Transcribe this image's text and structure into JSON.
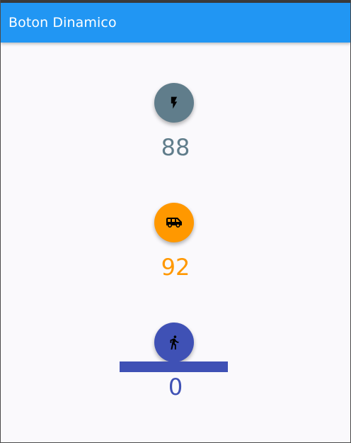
{
  "appbar": {
    "title": "Boton Dinamico"
  },
  "colors": {
    "appbar": "#2196f3",
    "slate": "#607d8b",
    "orange": "#ff9800",
    "indigo": "#3f51b5"
  },
  "items": [
    {
      "icon": "flash-icon",
      "value": "88"
    },
    {
      "icon": "van-icon",
      "value": "92"
    },
    {
      "icon": "walk-icon",
      "value": "0"
    }
  ]
}
